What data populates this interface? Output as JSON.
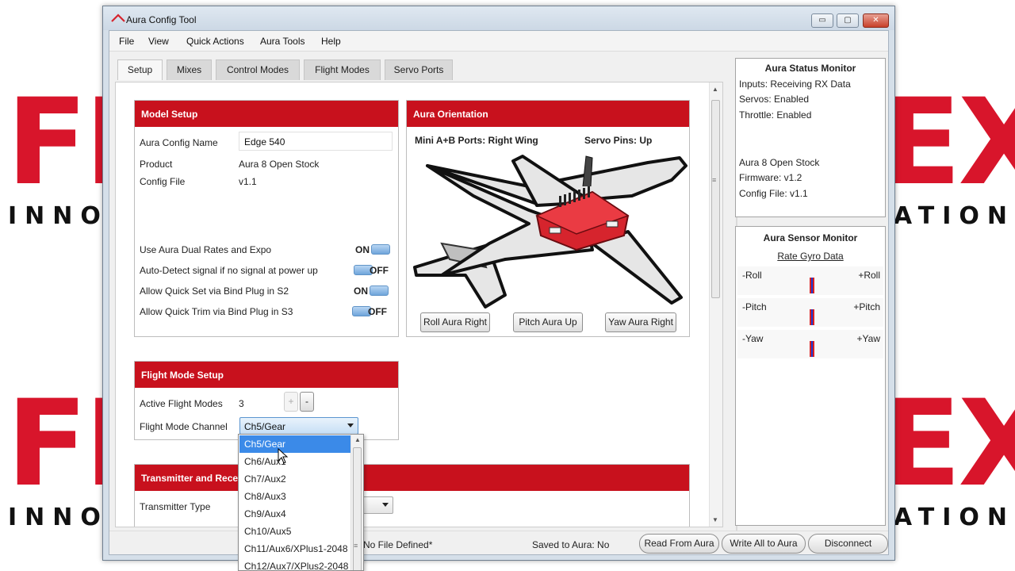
{
  "background": {
    "logo_big_left": "FR",
    "logo_big_right": "EX",
    "logo_tag_left": "INNO",
    "logo_tag_right": "ATION",
    "brand_red": "#d8152b"
  },
  "window": {
    "title": "Aura Config Tool",
    "icon": "aura-logo-icon",
    "controls": {
      "minimize": "▭",
      "maximize": "▢",
      "close": "✕"
    }
  },
  "menu": {
    "items": [
      "File",
      "View",
      "Quick Actions",
      "Aura Tools",
      "Help"
    ]
  },
  "tabs": {
    "items": [
      "Setup",
      "Mixes",
      "Control Modes",
      "Flight Modes",
      "Servo Ports"
    ],
    "active": "Setup"
  },
  "model_setup": {
    "header": "Model Setup",
    "config_name_label": "Aura Config Name",
    "config_name_value": "Edge 540",
    "product_label": "Product",
    "product_value": "Aura 8 Open Stock",
    "config_file_label": "Config File",
    "config_file_value": "v1.1",
    "options": [
      {
        "label": "Use Aura Dual Rates and Expo",
        "state": "ON"
      },
      {
        "label": "Auto-Detect signal if no signal at power up",
        "state": "OFF"
      },
      {
        "label": "Allow Quick Set via Bind Plug in S2",
        "state": "ON"
      },
      {
        "label": "Allow Quick Trim via Bind Plug in S3",
        "state": "OFF"
      }
    ]
  },
  "orientation": {
    "header": "Aura Orientation",
    "ports_text": "Mini A+B Ports: Right Wing",
    "pins_text": "Servo Pins: Up",
    "buttons": [
      "Roll Aura Right",
      "Pitch Aura Up",
      "Yaw Aura Right"
    ]
  },
  "flight_mode_setup": {
    "header": "Flight Mode Setup",
    "active_label": "Active Flight Modes",
    "active_value": "3",
    "plus": "+",
    "minus": "-",
    "channel_label": "Flight Mode Channel",
    "channel_value": "Ch5/Gear"
  },
  "transmitter": {
    "header": "Transmitter and Receiver",
    "type_label": "Transmitter Type"
  },
  "dropdown_options": [
    "Ch5/Gear",
    "Ch6/Aux1",
    "Ch7/Aux2",
    "Ch8/Aux3",
    "Ch9/Aux4",
    "Ch10/Aux5",
    "Ch11/Aux6/XPlus1-2048",
    "Ch12/Aux7/XPlus2-2048"
  ],
  "status_monitor": {
    "title": "Aura Status Monitor",
    "lines": [
      "Inputs:  Receiving RX Data",
      "Servos:  Enabled",
      "Throttle:  Enabled"
    ],
    "device_lines": [
      "Aura 8 Open Stock",
      "Firmware:  v1.2",
      "Config File:  v1.1"
    ]
  },
  "sensor_monitor": {
    "title": "Aura Sensor Monitor",
    "subtitle": "Rate Gyro Data",
    "axes": [
      {
        "neg": "-Roll",
        "pos": "+Roll",
        "value": 0
      },
      {
        "neg": "-Pitch",
        "pos": "+Pitch",
        "value": 0
      },
      {
        "neg": "-Yaw",
        "pos": "+Yaw",
        "value": 0
      }
    ]
  },
  "statusbar": {
    "file_text": "No File Defined*",
    "saved_text": "Saved to Aura: No",
    "buttons": [
      "Read From Aura",
      "Write All to Aura",
      "Disconnect"
    ]
  },
  "colors": {
    "section_header": "#c8111d",
    "toggle_knob": "#6fa5db",
    "dropdown_selected": "#3b8ae8",
    "aura_red": "#d6242d"
  }
}
